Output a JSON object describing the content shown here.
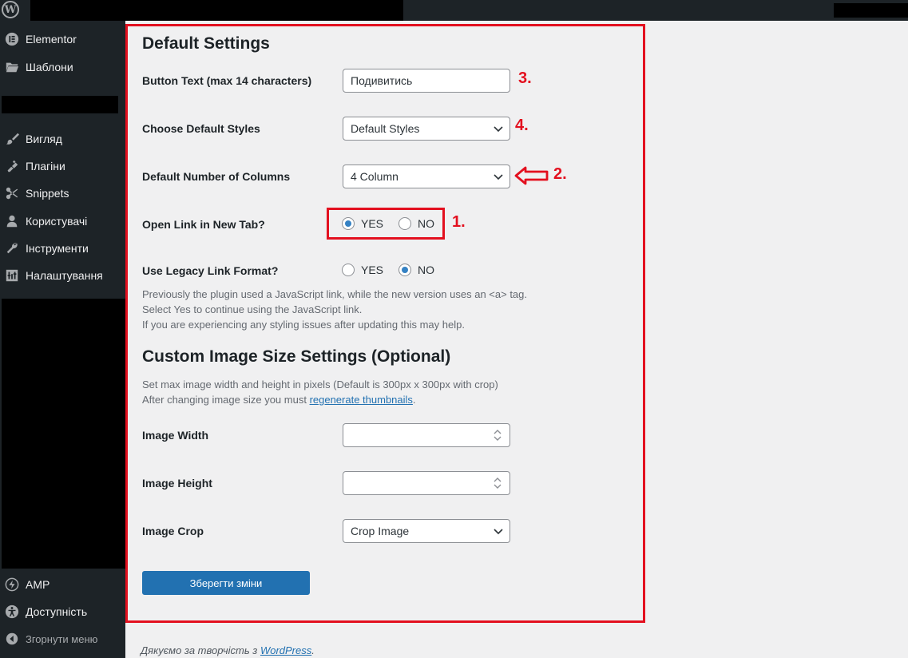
{
  "sidebar": {
    "items": [
      {
        "label": "Elementor",
        "icon": "elementor-icon"
      },
      {
        "label": "Шаблони",
        "icon": "folder-icon"
      },
      {
        "label": "Вигляд",
        "icon": "paintbrush-icon"
      },
      {
        "label": "Плагіни",
        "icon": "plugin-icon"
      },
      {
        "label": "Snippets",
        "icon": "scissors-icon"
      },
      {
        "label": "Користувачі",
        "icon": "user-icon"
      },
      {
        "label": "Інструменти",
        "icon": "wrench-icon"
      },
      {
        "label": "Налаштування",
        "icon": "settings-icon"
      },
      {
        "label": "AMP",
        "icon": "amp-icon"
      },
      {
        "label": "Доступність",
        "icon": "accessibility-icon"
      }
    ],
    "collapse_label": "Згорнути меню"
  },
  "main": {
    "default_heading": "Default Settings",
    "button_text_label": "Button Text (max 14 characters)",
    "button_text_value": "Подивитись",
    "default_styles_label": "Choose Default Styles",
    "default_styles_value": "Default Styles",
    "columns_label": "Default Number of Columns",
    "columns_value": "4 Column",
    "new_tab_label": "Open Link in New Tab?",
    "new_tab_value": "YES",
    "legacy_label": "Use Legacy Link Format?",
    "legacy_value": "NO",
    "yes_label": "YES",
    "no_label": "NO",
    "legacy_desc_1": "Previously the plugin used a JavaScript link, while the new version uses an <a> tag.",
    "legacy_desc_2": "Select Yes to continue using the JavaScript link.",
    "legacy_desc_3": "If you are experiencing any styling issues after updating this may help.",
    "custom_heading": "Custom Image Size Settings (Optional)",
    "custom_desc_1": "Set max image width and height in pixels (Default is 300px x 300px with crop)",
    "custom_desc_2_prefix": "After changing image size you must ",
    "custom_desc_2_link": "regenerate thumbnails",
    "custom_desc_2_suffix": ".",
    "image_width_label": "Image Width",
    "image_width_value": "",
    "image_height_label": "Image Height",
    "image_height_value": "",
    "image_crop_label": "Image Crop",
    "image_crop_value": "Crop Image",
    "save_label": "Зберегти зміни"
  },
  "annotations": {
    "a1": "1.",
    "a2": "2.",
    "a3": "3.",
    "a4": "4.",
    "color": "#e3101f"
  },
  "footer": {
    "prefix": "Дякуємо за творчість з ",
    "link": "WordPress",
    "suffix": "."
  }
}
